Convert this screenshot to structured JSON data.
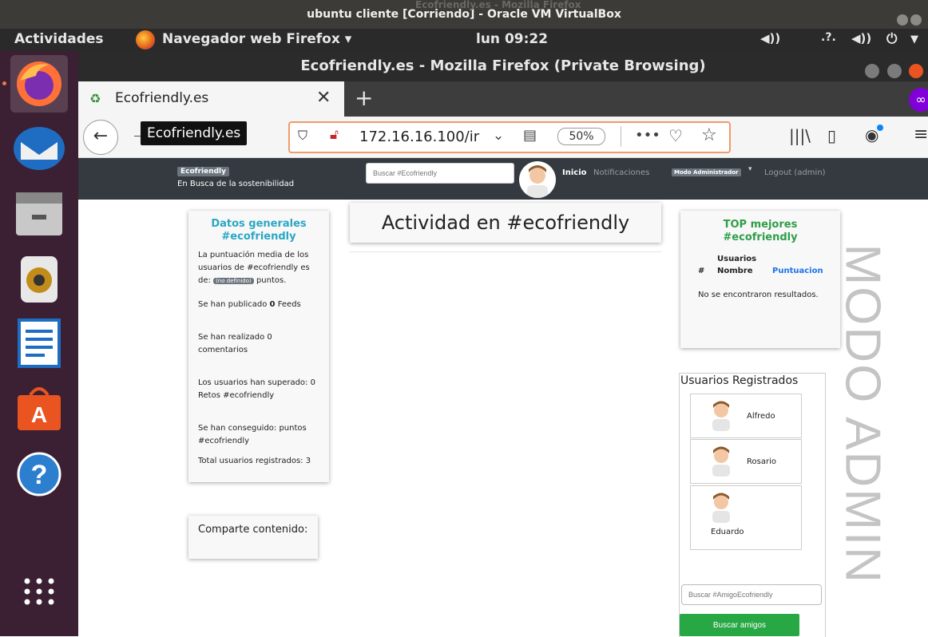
{
  "vbox": {
    "title": "ubuntu cliente [Corriendo] - Oracle VM VirtualBox",
    "ghost_title": "Ecofriendly.es - Mozilla Firefox"
  },
  "topbar": {
    "activities": "Actividades",
    "app": "Navegador web Firefox ▾",
    "clock": "lun 09:22"
  },
  "firefox": {
    "window_title": "Ecofriendly.es - Mozilla Firefox (Private Browsing)",
    "tab_title": "Ecofriendly.es",
    "tooltip": "Ecofriendly.es",
    "url": "172.16.16.100/ir",
    "zoom": "50%"
  },
  "site": {
    "brand": "Ecofriendly",
    "tagline": "En Busca de la sostenibilidad",
    "search_placeholder": "Buscar #Ecofriendly",
    "nav_home": "Inicio",
    "nav_notifications": "Notificaciones",
    "admin_badge": "Modo Administrador",
    "logout": "Logout (admin)",
    "general": {
      "title": "Datos generales #ecofriendly",
      "avg_text": "La puntuación media de los usuarios de #ecofriendly es de:",
      "avg_badge": "(no definido)",
      "avg_suffix": "puntos.",
      "feeds_pre": "Se han publicado",
      "feeds_num": "0",
      "feeds_post": "Feeds",
      "comments": "Se han realizado 0 comentarios",
      "retos": "Los usuarios han superado: 0 Retos #ecofriendly",
      "points": "Se han conseguido: puntos #ecofriendly",
      "total": "Total usuarios registrados: 3"
    },
    "share": "Comparte contenido:",
    "activity_title": "Actividad en #ecofriendly",
    "top": {
      "title": "TOP mejores #ecofriendly",
      "users_header": "Usuarios",
      "col_hash": "#",
      "col_name": "Nombre",
      "col_score": "Puntuacion",
      "empty": "No se encontraron resultados."
    },
    "registered": {
      "title": "Usuarios Registrados",
      "users": [
        "Alfredo",
        "Rosario",
        "Eduardo"
      ],
      "search_placeholder": "Buscar #AmigoEcofriendly",
      "search_button": "Buscar amigos"
    },
    "watermark": "MODO ADMIN"
  }
}
